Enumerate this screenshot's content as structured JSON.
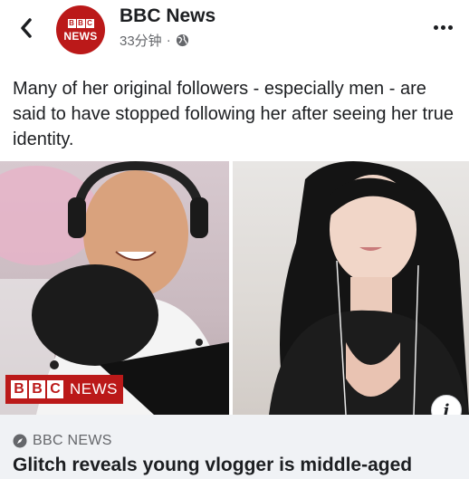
{
  "header": {
    "page_name": "BBC News",
    "avatar_blocks": [
      "B",
      "B",
      "C"
    ],
    "avatar_word": "NEWS",
    "timestamp": "33分钟",
    "separator": "·",
    "audience_icon": "globe-icon",
    "back_icon": "chevron-left-icon",
    "more_icon": "more-horizontal-icon"
  },
  "post": {
    "text": "Many of her original followers - especially men - are said to have stopped following her after seeing her true identity."
  },
  "media": {
    "watermark_blocks": [
      "B",
      "B",
      "C"
    ],
    "watermark_word": "NEWS",
    "info_label": "i"
  },
  "link_card": {
    "source_icon": "compass-icon",
    "source": "BBC NEWS",
    "headline": "Glitch reveals young vlogger is middle-aged"
  },
  "colors": {
    "brand_red": "#bb1919",
    "text_primary": "#1c1e21",
    "text_secondary": "#65676b",
    "card_bg": "#f0f2f5"
  }
}
